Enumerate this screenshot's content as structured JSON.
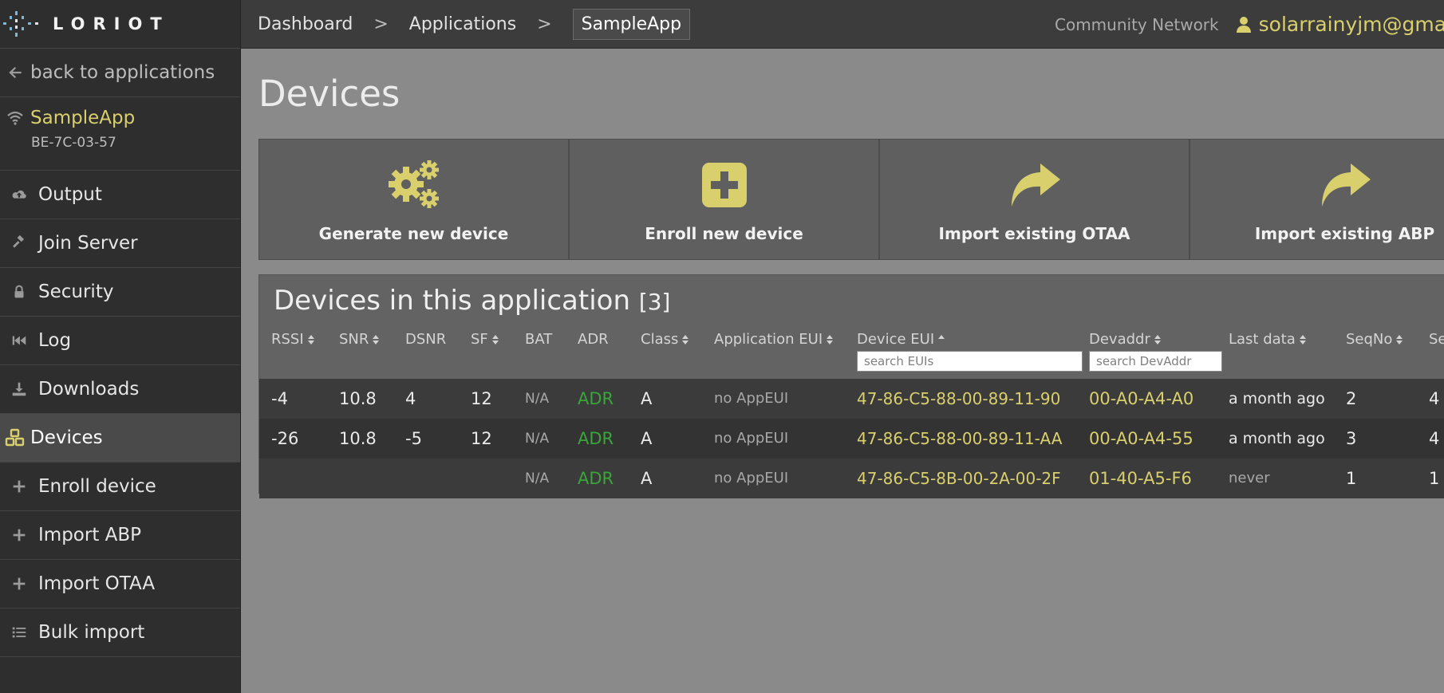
{
  "brand": {
    "logo_text": "LORIOT"
  },
  "sidebar": {
    "back_label": "back to applications",
    "app_name": "SampleApp",
    "app_id": "BE-7C-03-57",
    "items": [
      {
        "label": "Output",
        "icon": "cloud-upload-icon"
      },
      {
        "label": "Join Server",
        "icon": "gavel-icon"
      },
      {
        "label": "Security",
        "icon": "lock-icon"
      },
      {
        "label": "Log",
        "icon": "fast-backward-icon"
      },
      {
        "label": "Downloads",
        "icon": "download-icon"
      },
      {
        "label": "Devices",
        "icon": "cubes-icon",
        "active": true
      },
      {
        "label": "Enroll device",
        "icon": "plus-icon"
      },
      {
        "label": "Import ABP",
        "icon": "plus-icon"
      },
      {
        "label": "Import OTAA",
        "icon": "plus-icon"
      },
      {
        "label": "Bulk import",
        "icon": "list-icon"
      }
    ]
  },
  "topbar": {
    "breadcrumb": [
      "Dashboard",
      "Applications",
      "SampleApp"
    ],
    "separator": ">",
    "network": "Community Network",
    "user": "solarrainyjm@gmail"
  },
  "main": {
    "title": "Devices",
    "actions": [
      {
        "label": "Generate new device",
        "icon": "gears-icon"
      },
      {
        "label": "Enroll new device",
        "icon": "plus-square-icon"
      },
      {
        "label": "Import existing OTAA",
        "icon": "share-icon"
      },
      {
        "label": "Import existing ABP",
        "icon": "share-icon"
      }
    ]
  },
  "devices": {
    "title": "Devices in this application",
    "count": "[3]",
    "columns": [
      "RSSI",
      "SNR",
      "DSNR",
      "SF",
      "BAT",
      "ADR",
      "Class",
      "Application EUI",
      "Device EUI",
      "Devaddr",
      "Last data",
      "SeqNo",
      "Se"
    ],
    "search_eui_placeholder": "search EUIs",
    "search_devaddr_placeholder": "search DevAddr",
    "rows": [
      {
        "rssi": "-4",
        "snr": "10.8",
        "dsnr": "4",
        "sf": "12",
        "bat": "N/A",
        "adr": "ADR",
        "class": "A",
        "app_eui": "no AppEUI",
        "dev_eui": "47-86-C5-88-00-89-11-90",
        "devaddr": "00-A0-A4-A0",
        "last_data": "a month ago",
        "seqno": "2",
        "se": "4"
      },
      {
        "rssi": "-26",
        "snr": "10.8",
        "dsnr": "-5",
        "sf": "12",
        "bat": "N/A",
        "adr": "ADR",
        "class": "A",
        "app_eui": "no AppEUI",
        "dev_eui": "47-86-C5-88-00-89-11-AA",
        "devaddr": "00-A0-A4-55",
        "last_data": "a month ago",
        "seqno": "3",
        "se": "4"
      },
      {
        "rssi": "",
        "snr": "",
        "dsnr": "",
        "sf": "",
        "bat": "N/A",
        "adr": "ADR",
        "class": "A",
        "app_eui": "no AppEUI",
        "dev_eui": "47-86-C5-8B-00-2A-00-2F",
        "devaddr": "01-40-A5-F6",
        "last_data": "never",
        "seqno": "1",
        "se": "1"
      }
    ]
  },
  "colors": {
    "accent": "#d9cf6d",
    "adr_green": "#3aa53a",
    "sidebar_bg": "#2e2e2e",
    "topbar_bg": "#3c3c3c",
    "content_bg": "#8a8a8a"
  }
}
